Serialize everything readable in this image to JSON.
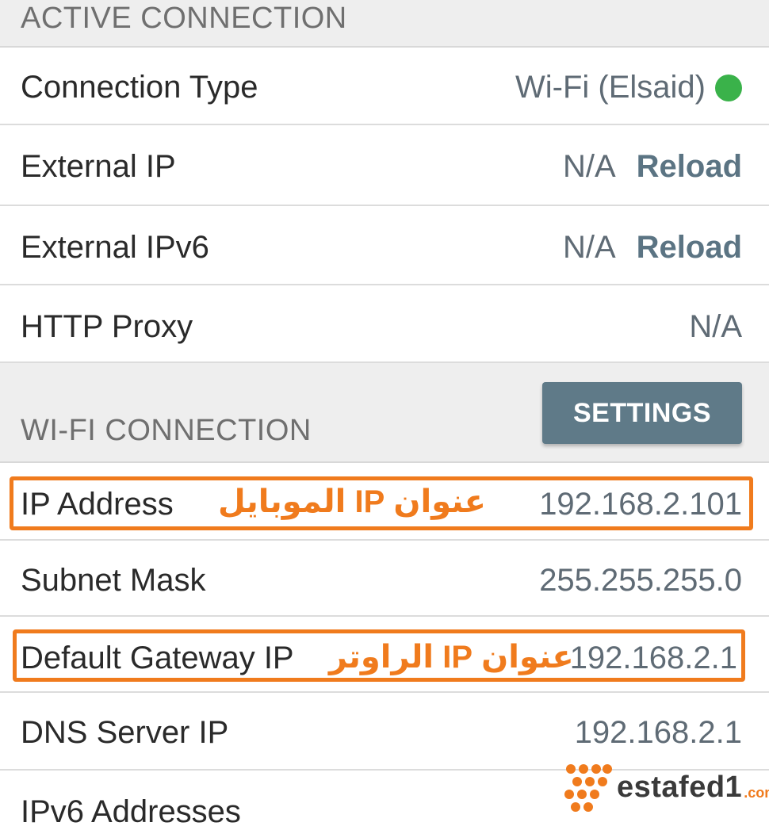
{
  "active_section": {
    "title": "ACTIVE CONNECTION"
  },
  "active_rows": [
    {
      "label": "Connection Type",
      "value": "Wi-Fi (Elsaid)",
      "status_color": "#3ab24a"
    },
    {
      "label": "External IP",
      "value": "N/A",
      "action": "Reload"
    },
    {
      "label": "External IPv6",
      "value": "N/A",
      "action": "Reload"
    },
    {
      "label": "HTTP Proxy",
      "value": "N/A"
    }
  ],
  "wifi_section": {
    "title": "WI-FI CONNECTION",
    "settings_label": "SETTINGS"
  },
  "wifi_rows": [
    {
      "label": "IP Address",
      "value": "192.168.2.101",
      "note": "عنوان IP الموبايل"
    },
    {
      "label": "Subnet Mask",
      "value": "255.255.255.0"
    },
    {
      "label": "Default Gateway IP",
      "value": "192.168.2.1",
      "note": "عنوان IP الراوتر"
    },
    {
      "label": "DNS Server IP",
      "value": "192.168.2.1"
    },
    {
      "label": "IPv6 Addresses"
    }
  ],
  "watermark": {
    "brand": "estafed1",
    "suffix": ".com"
  },
  "colors": {
    "accent_orange": "#f07b1d",
    "button": "#5f7a88",
    "status_green": "#3ab24a"
  }
}
